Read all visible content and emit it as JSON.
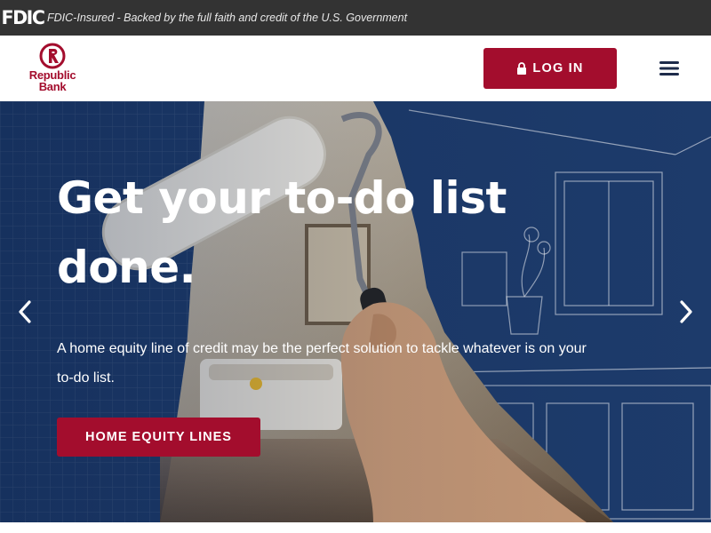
{
  "fdic_banner": {
    "logo_text": "FDIC",
    "statement": "FDIC-Insured - Backed by the full faith and credit of the U.S. Government"
  },
  "header": {
    "logo": {
      "line1": "Republic",
      "line2": "Bank",
      "icon": "republic-bank-logo-mark"
    },
    "login_label": "LOG IN",
    "login_icon": "lock-icon",
    "menu_icon": "hamburger-menu-icon"
  },
  "hero": {
    "title": "Get your to-do list done.",
    "subtitle": "A home equity line of credit may be the perfect solution to tackle whatever is on your to-do list.",
    "cta_label": "HOME EQUITY LINES",
    "prev_icon": "chevron-left-icon",
    "next_icon": "chevron-right-icon",
    "image": "hand-painting-bathroom-with-roller-over-blueprint-sketch"
  },
  "colors": {
    "brand_red": "#a30d2d",
    "hero_blue": "#1d3b6b",
    "banner_dark": "#333333"
  }
}
